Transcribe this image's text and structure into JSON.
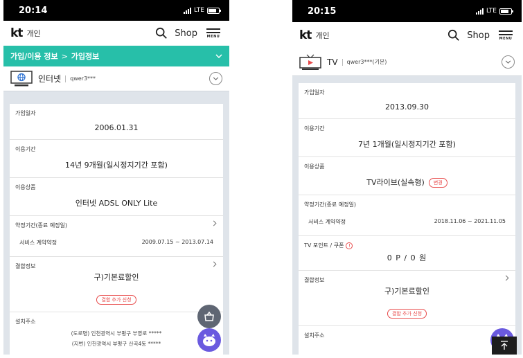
{
  "left": {
    "status": {
      "time": "20:14",
      "network": "LTE"
    },
    "header": {
      "logo": "kt",
      "subtitle": "개인",
      "shop_label": "Shop",
      "menu_label": "MENU"
    },
    "breadcrumb": {
      "item1": "가입/이용 정보",
      "separator": ">",
      "item2": "가입정보"
    },
    "service": {
      "name": "인터넷",
      "account": "qwer3***"
    },
    "sections": {
      "join_date": {
        "label": "가입일자",
        "value": "2006.01.31"
      },
      "usage_period": {
        "label": "이용기간",
        "value": "14년 9개월(일시정지기간 포함)"
      },
      "product": {
        "label": "이용상품",
        "value": "인터넷 ADSL ONLY Lite"
      },
      "contract": {
        "label": "약정기간(종료 예정일)",
        "row_label": "서비스 계약약정",
        "row_value": "2009.07.15 ~ 2013.07.14"
      },
      "bundle": {
        "label": "결합정보",
        "value": "구)기본료할인",
        "pill": "결합 추가 신청"
      },
      "address": {
        "label": "설치주소",
        "road": "(도로명) 인천광역시 부평구 부영로 *****",
        "lot": "(지번) 인천광역시 부평구 산곡4동 *****"
      }
    }
  },
  "right": {
    "status": {
      "time": "20:15",
      "network": "LTE"
    },
    "header": {
      "logo": "kt",
      "subtitle": "개인",
      "shop_label": "Shop",
      "menu_label": "MENU"
    },
    "service": {
      "name": "TV",
      "account": "qwer3***(기본)"
    },
    "sections": {
      "join_date": {
        "label": "가입일자",
        "value": "2013.09.30"
      },
      "usage_period": {
        "label": "이용기간",
        "value": "7년 1개월(일시정지기간 포함)"
      },
      "product": {
        "label": "이용상품",
        "value": "TV라이브(실속형)",
        "pill": "변경"
      },
      "contract": {
        "label": "약정기간(종료 예정일)",
        "row_label": "서비스 계약약정",
        "row_value": "2018.11.06 ~ 2021.11.05"
      },
      "points": {
        "label": "TV 포인트 / 쿠폰",
        "info": "!",
        "value": "0 P / 0 원"
      },
      "bundle": {
        "label": "결합정보",
        "value": "구)기본료할인",
        "pill": "결합 추가 신청"
      },
      "address": {
        "label": "설치주소"
      }
    }
  },
  "colors": {
    "accent": "#27bfa9",
    "alert": "#e84a4a",
    "chatbot": "#6a5adf"
  }
}
